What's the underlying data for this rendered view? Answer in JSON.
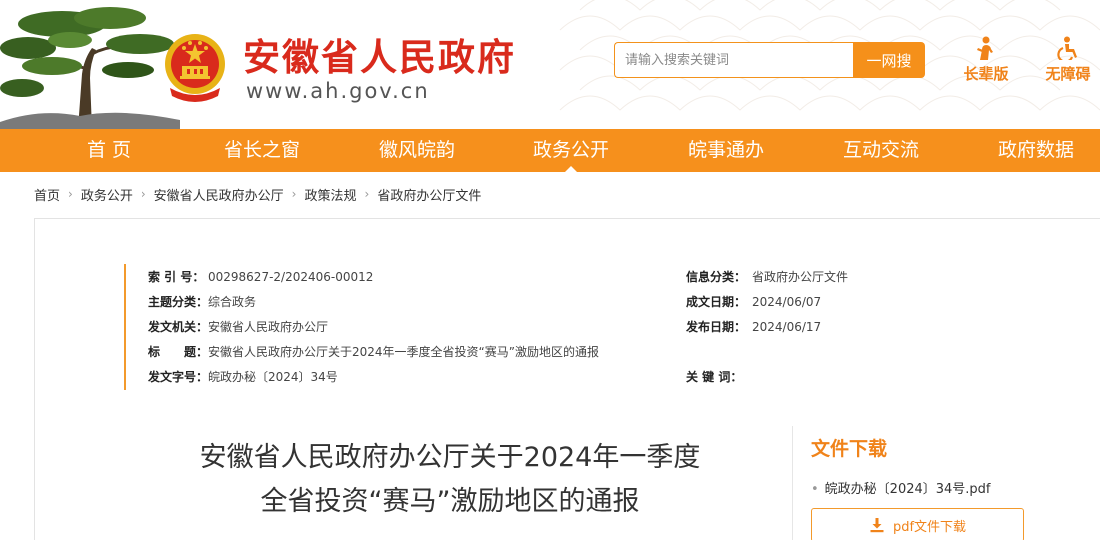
{
  "header": {
    "site_title": "安徽省人民政府",
    "site_url": "www.ah.gov.cn",
    "search_placeholder": "请输入搜索关键词",
    "search_button": "一网搜",
    "tools": [
      {
        "label": "长辈版",
        "icon": "elder-icon"
      },
      {
        "label": "无障碍",
        "icon": "accessibility-icon"
      }
    ],
    "colors": {
      "brand_red": "#d92a1c",
      "accent_orange": "#f6901c"
    }
  },
  "nav": {
    "items": [
      {
        "label": "首 页"
      },
      {
        "label": "省长之窗"
      },
      {
        "label": "徽风皖韵"
      },
      {
        "label": "政务公开",
        "active": true
      },
      {
        "label": "皖事通办"
      },
      {
        "label": "互动交流"
      },
      {
        "label": "政府数据"
      }
    ]
  },
  "breadcrumb": [
    "首页",
    "政务公开",
    "安徽省人民政府办公厅",
    "政策法规",
    "省政府办公厅文件"
  ],
  "meta": {
    "left": [
      {
        "key": "索 引 号：",
        "value": "00298627-2/202406-00012"
      },
      {
        "key": "主题分类：",
        "value": "综合政务"
      },
      {
        "key": "发文机关：",
        "value": "安徽省人民政府办公厅"
      },
      {
        "key": "标　　题：",
        "value": "安徽省人民政府办公厅关于2024年一季度全省投资“赛马”激励地区的通报"
      },
      {
        "key": "发文字号：",
        "value": "皖政办秘〔2024〕34号"
      }
    ],
    "right": [
      {
        "key": "信息分类：",
        "value": "省政府办公厅文件"
      },
      {
        "key": "成文日期：",
        "value": "2024/06/07"
      },
      {
        "key": "发布日期：",
        "value": "2024/06/17"
      },
      {
        "key": "关 键 词：",
        "value": ""
      }
    ]
  },
  "document": {
    "title_line1": "安徽省人民政府办公厅关于2024年一季度",
    "title_line2": "全省投资“赛马”激励地区的通报"
  },
  "downloads": {
    "title": "文件下载",
    "file_name": "皖政办秘〔2024〕34号.pdf",
    "button_label": "pdf文件下载"
  }
}
